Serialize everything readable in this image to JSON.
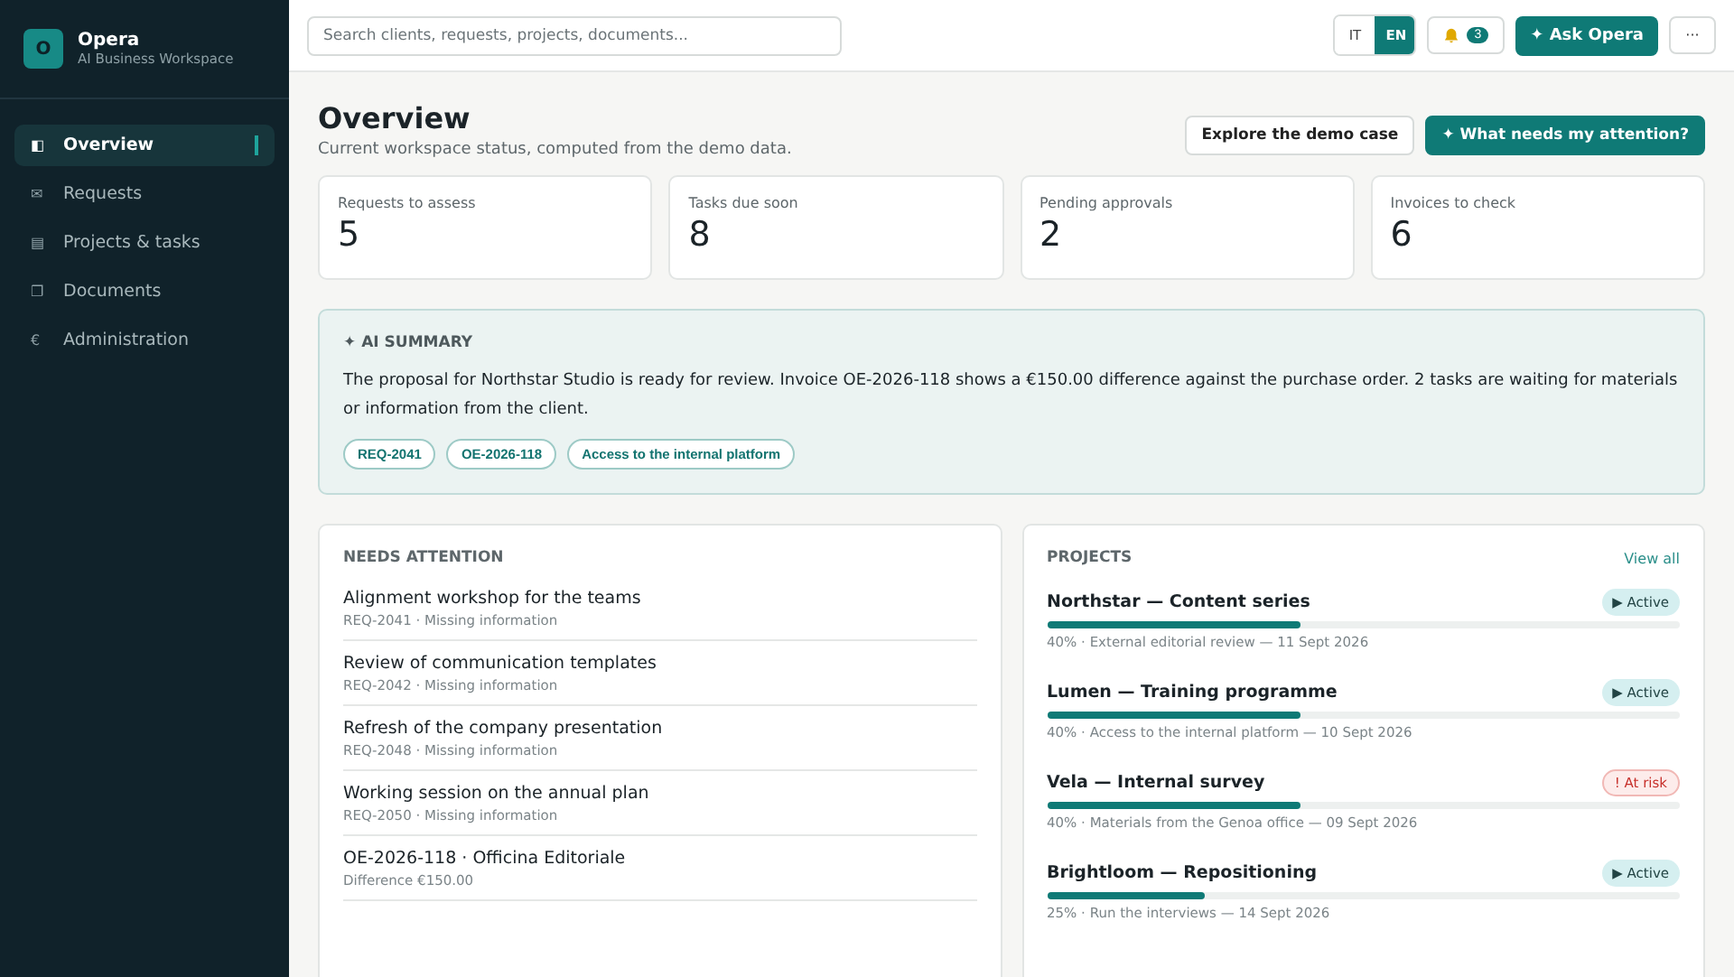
{
  "brand": {
    "logo": "O",
    "name": "Opera",
    "subtitle": "AI Business Workspace"
  },
  "nav": [
    {
      "icon": "◧",
      "label": "Overview",
      "selected": true
    },
    {
      "icon": "✉",
      "label": "Requests",
      "selected": false
    },
    {
      "icon": "▤",
      "label": "Projects & tasks",
      "selected": false
    },
    {
      "icon": "❐",
      "label": "Documents",
      "selected": false
    },
    {
      "icon": "€",
      "label": "Administration",
      "selected": false
    }
  ],
  "topbar": {
    "search": {
      "placeholder": "Search clients, requests, projects, documents..."
    },
    "languages": [
      {
        "label": "IT",
        "selected": false
      },
      {
        "label": "EN",
        "selected": true
      }
    ],
    "notifications": {
      "count": "3"
    },
    "ask": {
      "icon": "✦",
      "label": "Ask Opera"
    },
    "more": "···"
  },
  "header": {
    "title": "Overview",
    "subtitle": "Current workspace status, computed from the demo data.",
    "actions": [
      {
        "kind": "secondary",
        "label": "Explore the demo case"
      },
      {
        "kind": "primary",
        "icon": "✦",
        "label": "What needs my attention?"
      }
    ]
  },
  "stats": [
    {
      "label": "Requests to assess",
      "value": "5"
    },
    {
      "label": "Tasks due soon",
      "value": "8"
    },
    {
      "label": "Pending approvals",
      "value": "2"
    },
    {
      "label": "Invoices to check",
      "value": "6"
    }
  ],
  "summary": {
    "icon": "✦",
    "title": "AI SUMMARY",
    "text": "The proposal for Northstar Studio is ready for review. Invoice OE-2026-118 shows a €150.00 difference against the purchase order. 2 tasks are waiting for materials or information from the client.",
    "chips": [
      "REQ-2041",
      "OE-2026-118",
      "Access to the internal platform"
    ]
  },
  "attention": {
    "title": "NEEDS ATTENTION",
    "items": [
      {
        "title": "Alignment workshop for the teams",
        "meta": "REQ-2041 · Missing information"
      },
      {
        "title": "Review of communication templates",
        "meta": "REQ-2042 · Missing information"
      },
      {
        "title": "Refresh of the company presentation",
        "meta": "REQ-2048 · Missing information"
      },
      {
        "title": "Working session on the annual plan",
        "meta": "REQ-2050 · Missing information"
      },
      {
        "title": "OE-2026-118 · Officina Editoriale",
        "meta": "Difference €150.00"
      }
    ]
  },
  "projects": {
    "title": "PROJECTS",
    "link": "View all",
    "items": [
      {
        "name": "Northstar — Content series",
        "kind": "active",
        "status_icon": "▶",
        "status_label": "Active",
        "level": 0.4,
        "meta": "40% · External editorial review — 11 Sept 2026"
      },
      {
        "name": "Lumen — Training programme",
        "kind": "active",
        "status_icon": "▶",
        "status_label": "Active",
        "level": 0.4,
        "meta": "40% · Access to the internal platform — 10 Sept 2026"
      },
      {
        "name": "Vela — Internal survey",
        "kind": "at_risk",
        "status_icon": "!",
        "status_label": "At risk",
        "level": 0.4,
        "meta": "40% · Materials from the Genoa office — 09 Sept 2026"
      },
      {
        "name": "Brightloom — Repositioning",
        "kind": "active",
        "status_icon": "▶",
        "status_label": "Active",
        "level": 0.25,
        "meta": "25% · Run the interviews — 14 Sept 2026"
      }
    ]
  }
}
